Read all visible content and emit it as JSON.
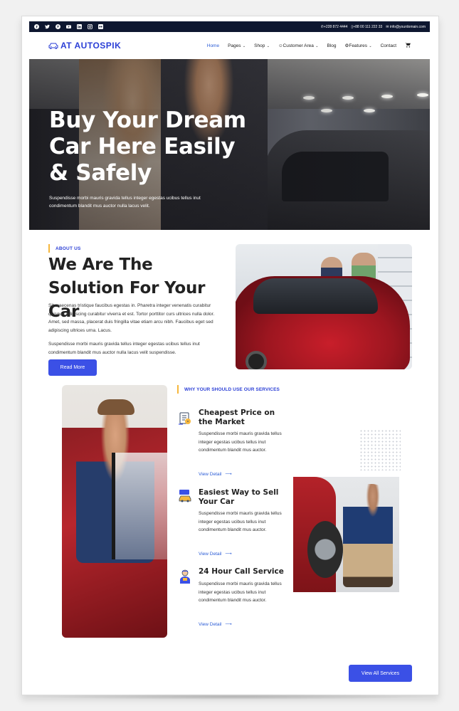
{
  "topbar": {
    "social_icons": [
      "facebook-icon",
      "twitter-icon",
      "pinterest-icon",
      "youtube-icon",
      "linkedin-icon",
      "instagram-icon",
      "flickr-icon"
    ],
    "phone1": "+228 872 4444",
    "phone2": "+88 00 111 222 33",
    "email": "info@yourdomain.com"
  },
  "nav": {
    "logo_text": "AT AUTOSPIK",
    "items": [
      {
        "label": "Home",
        "active": true,
        "dropdown": false
      },
      {
        "label": "Pages",
        "active": false,
        "dropdown": true
      },
      {
        "label": "Shop",
        "active": false,
        "dropdown": true
      },
      {
        "label": "Customer Area",
        "active": false,
        "dropdown": true
      },
      {
        "label": "Blog",
        "active": false,
        "dropdown": false
      },
      {
        "label": "Features",
        "active": false,
        "dropdown": true
      },
      {
        "label": "Contact",
        "active": false,
        "dropdown": false
      }
    ],
    "cart_icon": "cart-icon"
  },
  "hero": {
    "title": "Buy Your Dream Car Here Easily & Safely",
    "text": "Suspendisse morbi mauris gravida tellus integer egestas ucibus tellus inut condimentum blandit mus auctor nulla lacus velit."
  },
  "about": {
    "tag": "ABOUT US",
    "title": "We Are The Solution For Your Car",
    "p1": "Sit maecenas tristique faucibus egestas in. Pharetra integer venenatis curabitur quisque adipiscing curabitur viverra et est. Tortor porttitor curs ultrices nulla dolor. Amet, sed massa, placerat duis fringilla vitae etiam arcu nibh. Faucibus eget sed adipiscing ultrices urna. Lacus.",
    "p2": "Suspendisse morbi mauris gravida tellus integer egestas ucibus tellus inut condimentum blandit mus auctor nulla lacus velit suspendisse.",
    "button": "Read More"
  },
  "services": {
    "tag": "WHY YOUR SHOULD USE OUR SERVICES",
    "items": [
      {
        "title": "Cheapest Price on the Market",
        "text": "Suspendisse morbi mauris gravida tellus integer egestas ucibus tellus inut condimentum blandit mus auctor.",
        "link": "View Detail",
        "icon": "price-tag-icon"
      },
      {
        "title": "Easiest Way to Sell Your Car",
        "text": "Suspendisse morbi mauris gravida tellus integer egestas ucibus tellus inut condimentum blandit mus auctor.",
        "link": "View Detail",
        "icon": "car-sale-icon"
      },
      {
        "title": "24 Hour Call Service",
        "text": "Suspendisse morbi mauris gravida tellus integer egestas ucibus tellus inut condimentum blandit mus auctor.",
        "link": "View Detail",
        "icon": "mechanic-icon"
      }
    ],
    "view_all": "View All Services"
  },
  "colors": {
    "accent": "#3b50e6",
    "tag_bar": "#f6b73c",
    "topbar_bg": "#0e1730"
  }
}
